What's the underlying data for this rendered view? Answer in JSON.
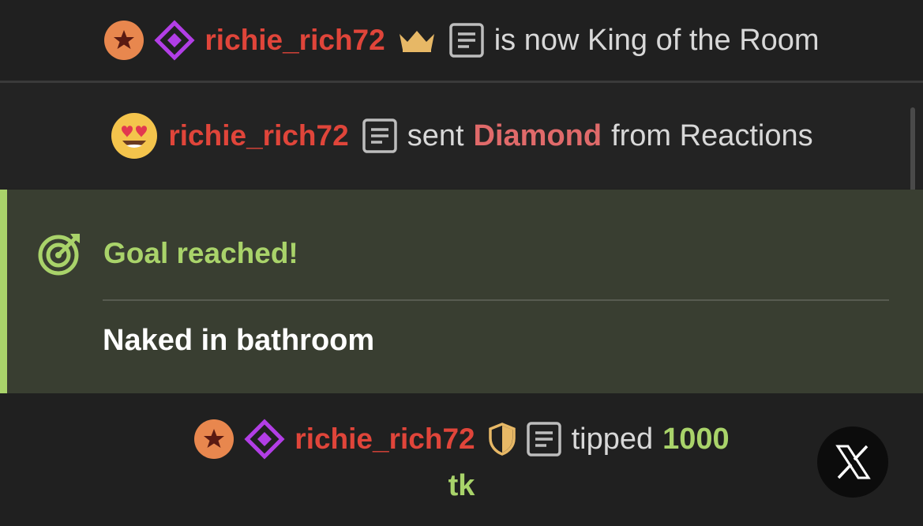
{
  "messages": {
    "king": {
      "username": "richie_rich72",
      "text": "is now King of the Room",
      "icons": [
        "star-badge-icon",
        "diamond-badge-icon",
        "crown-icon",
        "notes-icon"
      ]
    },
    "reaction": {
      "username": "richie_rich72",
      "text_before": "sent",
      "item": "Diamond",
      "text_after": "from Reactions",
      "icons": [
        "heart-eyes-emoji-icon",
        "notes-icon"
      ]
    },
    "goal": {
      "title": "Goal reached!",
      "description": "Naked in bathroom",
      "icon": "target-icon"
    },
    "tip": {
      "username": "richie_rich72",
      "text": "tipped",
      "amount": "1000",
      "unit": "tk",
      "icons": [
        "star-badge-icon",
        "diamond-badge-icon",
        "shield-icon",
        "notes-icon"
      ]
    }
  },
  "close_button": {
    "icon": "x-logo-icon"
  },
  "colors": {
    "background": "#202020",
    "username": "#e0453a",
    "accent_green": "#a9d36a",
    "goal_background": "#393e31",
    "badge_orange": "#e8874e",
    "badge_purple": "#b23ee6",
    "crown_gold": "#e7b866"
  }
}
